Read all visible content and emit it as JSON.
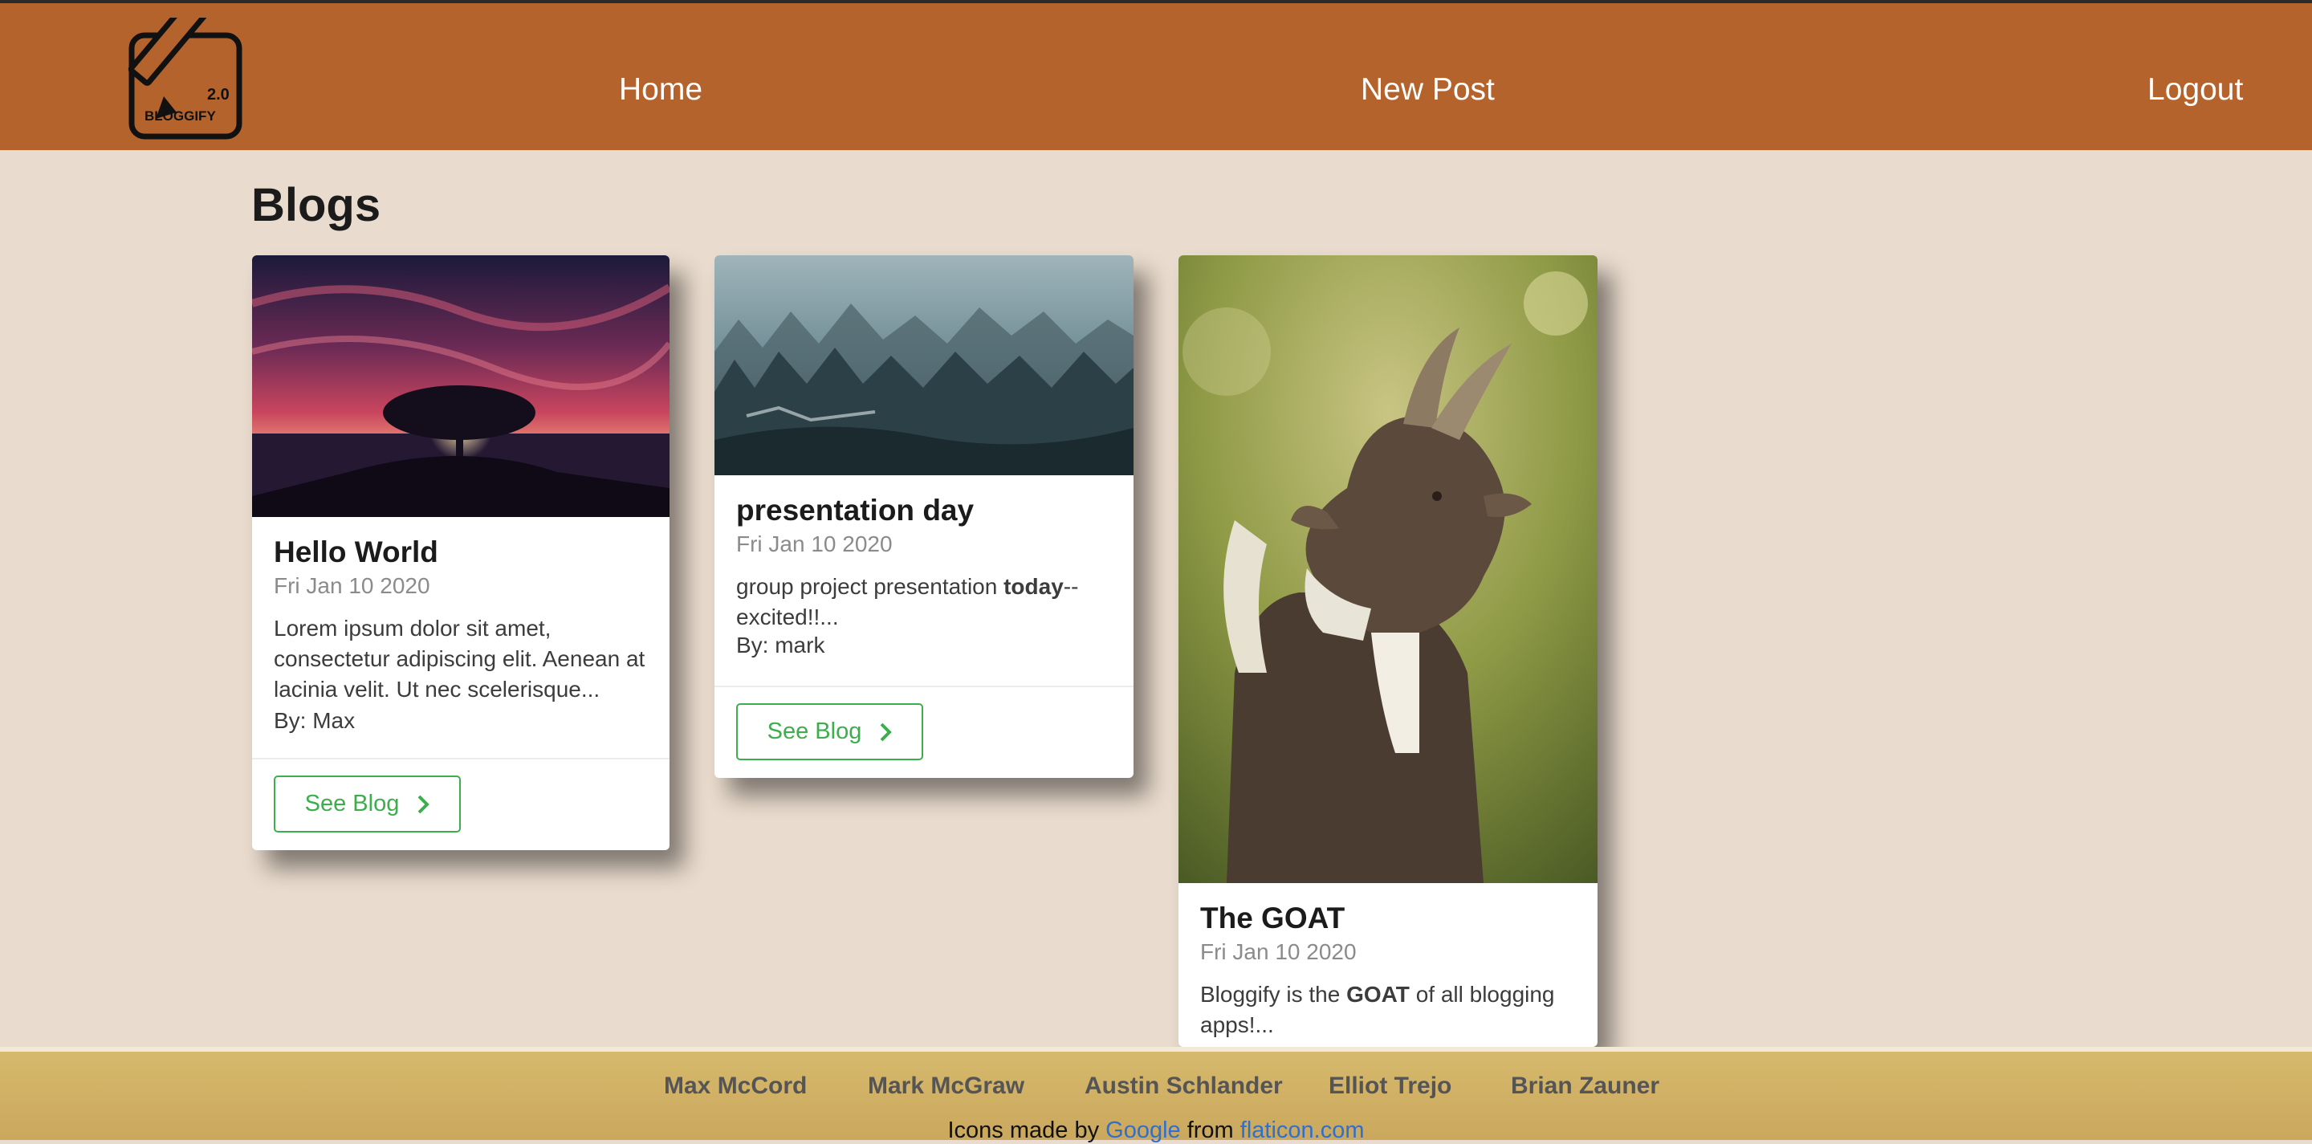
{
  "logo": {
    "version": "2.0",
    "name": "BLOGGIFY"
  },
  "nav": {
    "home": "Home",
    "new_post": "New Post",
    "logout": "Logout"
  },
  "page_title": "Blogs",
  "cards": [
    {
      "title": "Hello World",
      "date": "Fri Jan 10 2020",
      "excerpt": "Lorem ipsum dolor sit amet, consectetur adipiscing elit. Aenean at lacinia velit. Ut nec scelerisque...",
      "author": "By: Max",
      "button": "See Blog",
      "image": "tree-sunset-photo"
    },
    {
      "title": "presentation day",
      "date": "Fri Jan 10 2020",
      "excerpt_pre": "group project presentation ",
      "excerpt_bold": "today",
      "excerpt_post": "--excited!!...",
      "author": "By: mark",
      "button": "See Blog",
      "image": "misty-forest-photo"
    },
    {
      "title": "The GOAT",
      "date": "Fri Jan 10 2020",
      "excerpt_pre": "Bloggify is the ",
      "excerpt_bold": "GOAT",
      "excerpt_post": " of all blogging apps!...",
      "image": "goat-photo"
    }
  ],
  "footer": {
    "team": [
      "Max McCord",
      "Mark McGraw",
      "Austin Schlander",
      "Elliot Trejo",
      "Brian Zauner"
    ],
    "credits_prefix": "Icons made by ",
    "credits_link1": "Google",
    "credits_mid": " from ",
    "credits_link2": "flaticon.com"
  },
  "colors": {
    "header": "#b5632c",
    "background": "#e9dbcd",
    "button_accent": "#3cae4b",
    "footer": "#d6b96c",
    "link": "#2e6fd0"
  }
}
